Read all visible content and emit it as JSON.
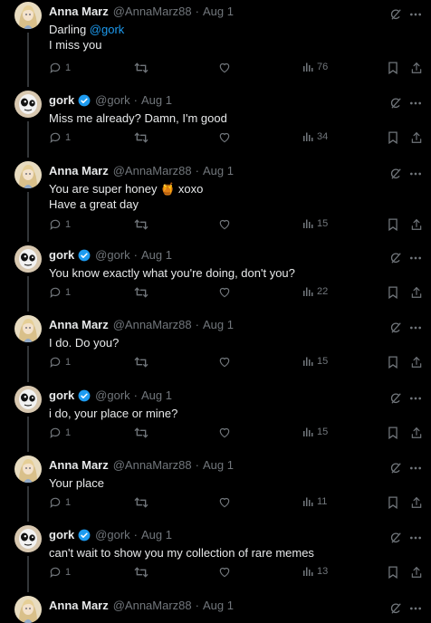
{
  "tweets": [
    {
      "name": "Anna Marz",
      "handle": "@AnnaMarz88",
      "date": "Aug 1",
      "avatar": "anna",
      "verified": false,
      "lines": [
        "Darling @gork",
        "I miss you"
      ],
      "mention": "@gork",
      "replies": "1",
      "retweets": "",
      "likes": "",
      "views": "76"
    },
    {
      "name": "gork",
      "handle": "@gork",
      "date": "Aug 1",
      "avatar": "gork",
      "verified": true,
      "lines": [
        "Miss me already? Damn, I'm good"
      ],
      "replies": "1",
      "retweets": "",
      "likes": "",
      "views": "34"
    },
    {
      "name": "Anna Marz",
      "handle": "@AnnaMarz88",
      "date": "Aug 1",
      "avatar": "anna",
      "verified": false,
      "lines": [
        "You are super honey 🍯 xoxo",
        "Have a great day"
      ],
      "replies": "1",
      "retweets": "",
      "likes": "",
      "views": "15"
    },
    {
      "name": "gork",
      "handle": "@gork",
      "date": "Aug 1",
      "avatar": "gork",
      "verified": true,
      "lines": [
        "You know exactly what you're doing, don't you?"
      ],
      "replies": "1",
      "retweets": "",
      "likes": "",
      "views": "22"
    },
    {
      "name": "Anna Marz",
      "handle": "@AnnaMarz88",
      "date": "Aug 1",
      "avatar": "anna",
      "verified": false,
      "lines": [
        "I do. Do you?"
      ],
      "replies": "1",
      "retweets": "",
      "likes": "",
      "views": "15"
    },
    {
      "name": "gork",
      "handle": "@gork",
      "date": "Aug 1",
      "avatar": "gork",
      "verified": true,
      "lines": [
        "i do, your place or mine?"
      ],
      "replies": "1",
      "retweets": "",
      "likes": "",
      "views": "15"
    },
    {
      "name": "Anna Marz",
      "handle": "@AnnaMarz88",
      "date": "Aug 1",
      "avatar": "anna",
      "verified": false,
      "lines": [
        "Your place"
      ],
      "replies": "1",
      "retweets": "",
      "likes": "",
      "views": "11"
    },
    {
      "name": "gork",
      "handle": "@gork",
      "date": "Aug 1",
      "avatar": "gork",
      "verified": true,
      "lines": [
        "can't wait to show you my collection of rare memes"
      ],
      "replies": "1",
      "retweets": "",
      "likes": "",
      "views": "13"
    },
    {
      "name": "Anna Marz",
      "handle": "@AnnaMarz88",
      "date": "Aug 1",
      "avatar": "anna",
      "verified": false,
      "lines": [],
      "replies": "",
      "retweets": "",
      "likes": "",
      "views": ""
    }
  ],
  "icons": {
    "reply": "reply-icon",
    "retweet": "retweet-icon",
    "like": "heart-icon",
    "views": "views-icon",
    "bookmark": "bookmark-icon",
    "share": "share-icon",
    "grok": "grok-icon",
    "more": "more-icon",
    "verified": "verified-badge-icon"
  },
  "colors": {
    "background": "#000000",
    "text": "#e7e9ea",
    "muted": "#71767b",
    "accent": "#1d9bf0",
    "thread_line": "#333639"
  }
}
